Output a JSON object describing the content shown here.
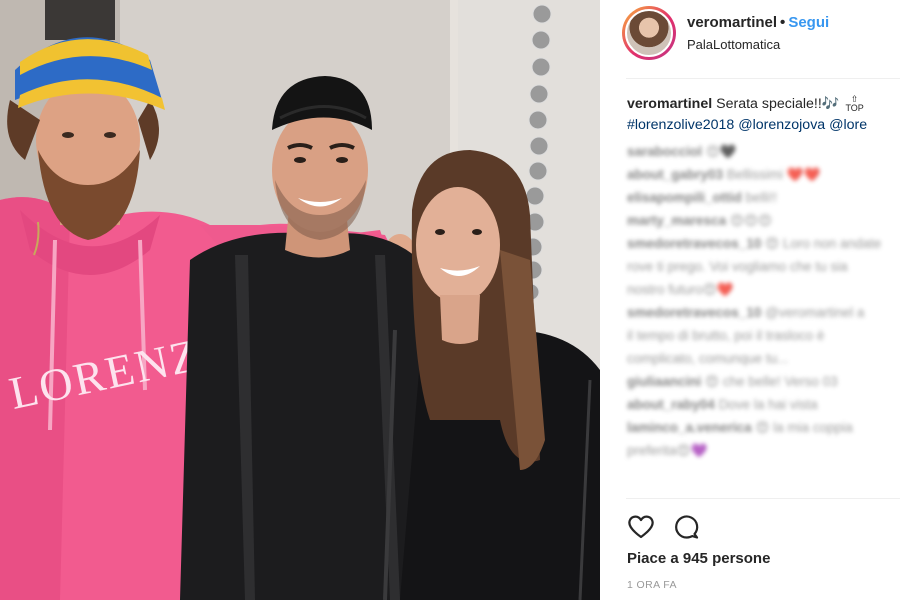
{
  "post": {
    "username": "veromartinel",
    "follow_label": "Segui",
    "location": "PalaLottomatica",
    "caption_text": "Serata speciale!!🎶",
    "top_badge": "TOP",
    "hashtags": "#lorenzolive2018 @lorenzojova @lore",
    "hoodie_print": "LORENZO"
  },
  "comments": [
    {
      "user": "sarabocciol",
      "text": "😍🖤"
    },
    {
      "user": "about_gabry03",
      "text": "Bellissimi ❤️❤️"
    },
    {
      "user": "elisapompili_ottid",
      "text": "belli!!"
    },
    {
      "user": "marty_maresca",
      "text": "😍😍😍"
    },
    {
      "user": "smedoretravecos_10",
      "text": "😍 Loro non andate"
    },
    {
      "user": "",
      "text": "rove ti prego. Voi vogliamo che tu sia"
    },
    {
      "user": "",
      "text": "nostro futuro😍❤️"
    },
    {
      "user": "smedoretravecos_10",
      "text": "@veromartinel a"
    },
    {
      "user": "",
      "text": "il tempo di brutto, poi il trasloco è"
    },
    {
      "user": "",
      "text": "complicato, comunque tu..."
    },
    {
      "user": "giuliaancini",
      "text": "😍 che belle! Verso 03"
    },
    {
      "user": "about_raby04",
      "text": "Dove la hai vista"
    },
    {
      "user": "laminco_a.venerica",
      "text": "😍 la mia coppia"
    },
    {
      "user": "",
      "text": "preferita😍💜"
    }
  ],
  "actions": {
    "like_icon": "heart-icon",
    "comment_icon": "comment-bubble-icon"
  },
  "likes_text": "Piace a 945 persone",
  "timestamp": "1 ORA FA",
  "colors": {
    "follow": "#3897f0",
    "hashtag": "#003569",
    "text": "#262626",
    "muted": "#999999"
  }
}
